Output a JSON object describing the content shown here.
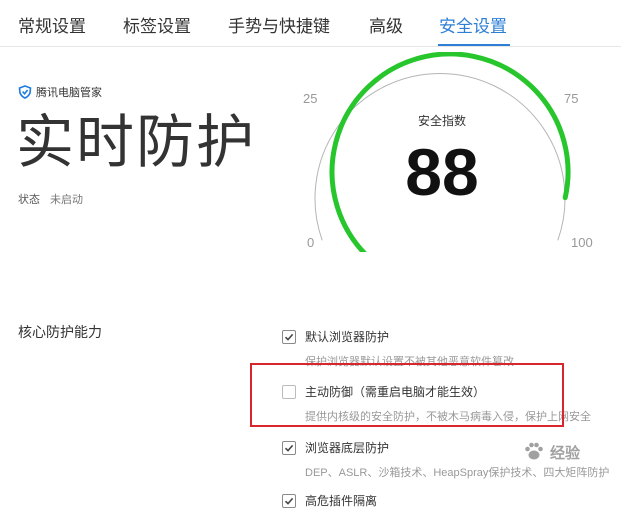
{
  "tabs": [
    {
      "label": "常规设置"
    },
    {
      "label": "标签设置"
    },
    {
      "label": "手势与快捷键"
    },
    {
      "label": "高级"
    },
    {
      "label": "安全设置"
    }
  ],
  "active_tab_index": 4,
  "accent_color": "#2d7fd6",
  "gauge_color": "#26c62c",
  "highlight_color": "#d9262c",
  "protection": {
    "brand_icon": "tencent-shield-icon",
    "brand": "腾讯电脑管家",
    "title": "实时防护",
    "status_label": "状态",
    "status_value": "未启动"
  },
  "gauge": {
    "label": "安全指数",
    "value": "88",
    "score": 88,
    "ticks": [
      "0",
      "25",
      "75",
      "100"
    ]
  },
  "core": {
    "section_label": "核心防护能力",
    "options": [
      {
        "label": "默认浏览器防护",
        "desc": "保护浏览器默认设置不被其他恶意软件篡改",
        "checked": true
      },
      {
        "label": "主动防御（需重启电脑才能生效）",
        "desc": "提供内核级的安全防护，不被木马病毒入侵，保护上网安全",
        "checked": false
      },
      {
        "label": "浏览器底层防护",
        "desc": "DEP、ASLR、沙箱技术、HeapSpray保护技术、四大矩阵防护",
        "checked": true
      },
      {
        "label": "高危插件隔离",
        "checked": true
      }
    ]
  }
}
